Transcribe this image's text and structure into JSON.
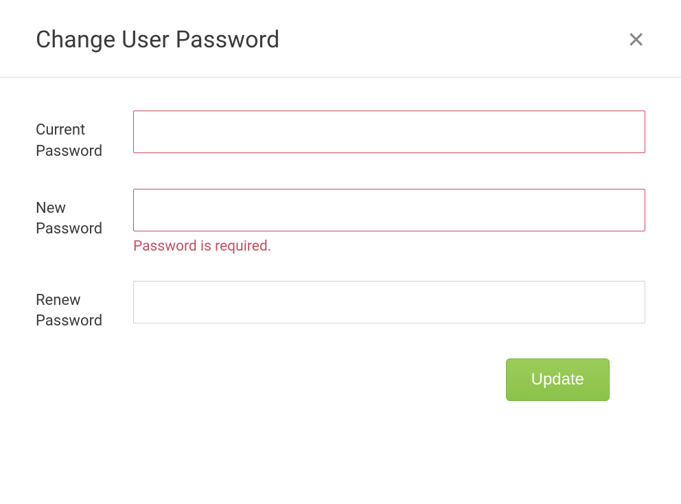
{
  "modal": {
    "title": "Change User Password",
    "fields": {
      "current": {
        "label": "Current Password",
        "value": ""
      },
      "new": {
        "label": "New Password",
        "value": "",
        "error": "Password is required."
      },
      "renew": {
        "label": "Renew Password",
        "value": ""
      }
    },
    "submit_label": "Update"
  }
}
